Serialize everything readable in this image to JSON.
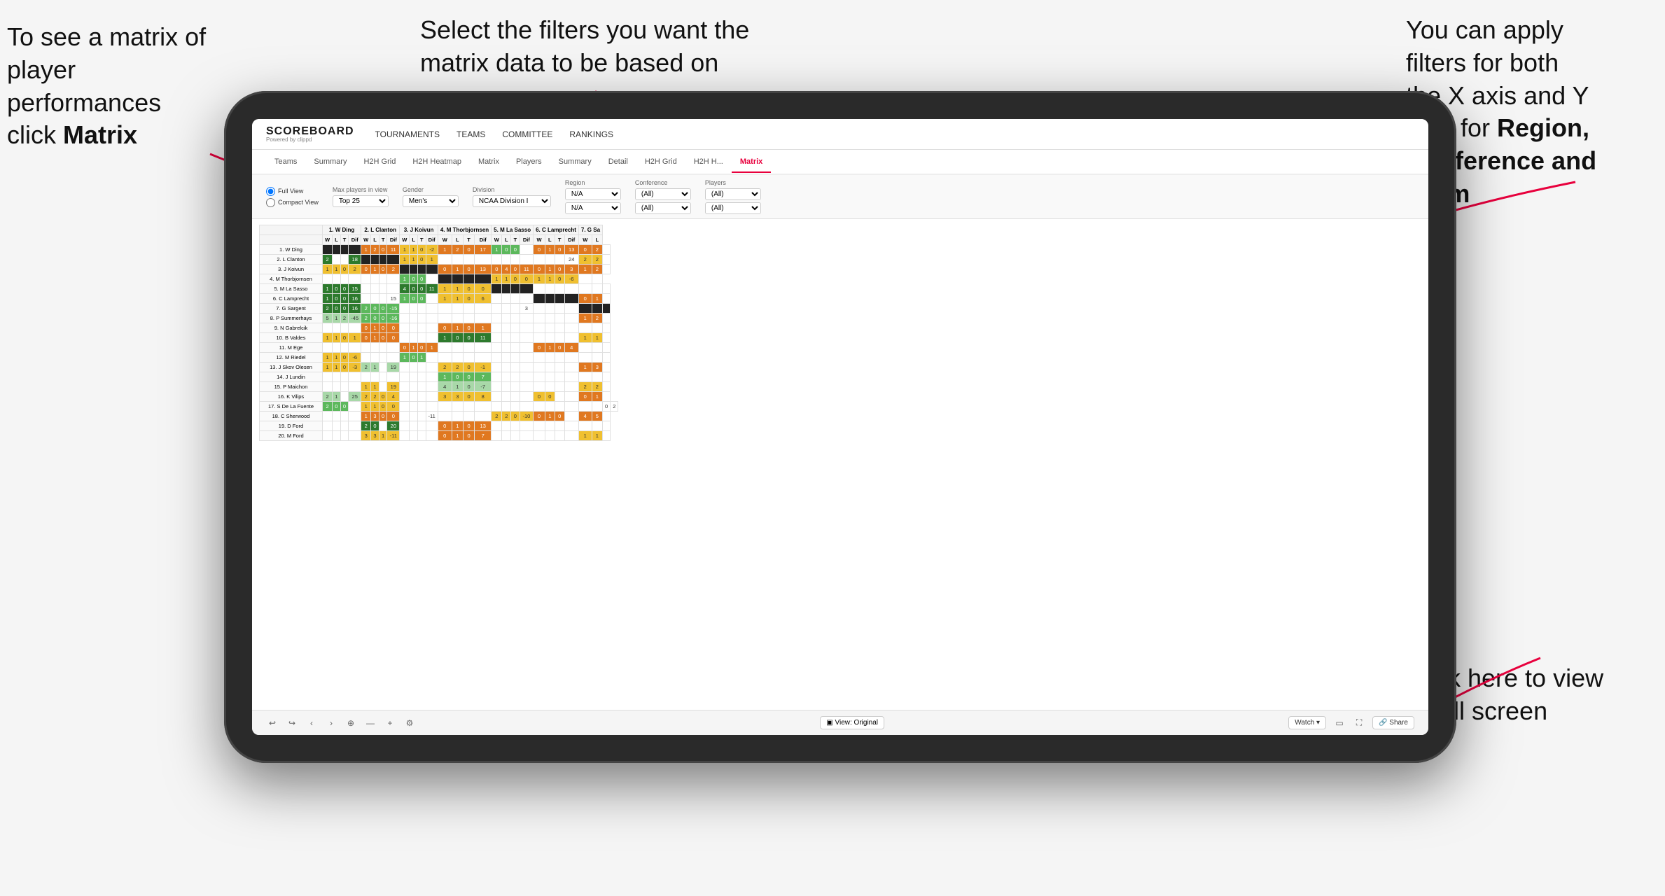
{
  "annotations": {
    "top_left": {
      "line1": "To see a matrix of",
      "line2": "player performances",
      "line3_plain": "click ",
      "line3_bold": "Matrix"
    },
    "top_center": {
      "text": "Select the filters you want the matrix data to be based on"
    },
    "top_right": {
      "line1": "You  can apply",
      "line2": "filters for both",
      "line3": "the X axis and Y",
      "line4_plain": "Axis for ",
      "line4_bold": "Region,",
      "line5_bold": "Conference and",
      "line6_bold": "Team"
    },
    "bottom_right": {
      "line1": "Click here to view",
      "line2": "in full screen"
    }
  },
  "nav": {
    "logo": "SCOREBOARD",
    "logo_sub": "Powered by clippd",
    "items": [
      "TOURNAMENTS",
      "TEAMS",
      "COMMITTEE",
      "RANKINGS"
    ]
  },
  "tabs": {
    "player_tabs": [
      "Teams",
      "Summary",
      "H2H Grid",
      "H2H Heatmap",
      "Matrix",
      "Players",
      "Summary",
      "Detail",
      "H2H Grid",
      "H2H H...",
      "Matrix"
    ],
    "active_tab": "Matrix"
  },
  "filters": {
    "view_options": [
      "Full View",
      "Compact View"
    ],
    "max_players_label": "Max players in view",
    "max_players_value": "Top 25",
    "gender_label": "Gender",
    "gender_value": "Men's",
    "division_label": "Division",
    "division_value": "NCAA Division I",
    "region_label": "Region",
    "region_value1": "N/A",
    "region_value2": "N/A",
    "conference_label": "Conference",
    "conference_value1": "(All)",
    "conference_value2": "(All)",
    "players_label": "Players",
    "players_value1": "(All)",
    "players_value2": "(All)"
  },
  "matrix": {
    "col_headers": [
      "1. W Ding",
      "2. L Clanton",
      "3. J Koivun",
      "4. M Thorbjornsen",
      "5. M La Sasso",
      "6. C Lamprecht",
      "7. G Sa"
    ],
    "sub_headers": [
      "W",
      "L",
      "T",
      "Dif"
    ],
    "rows": [
      {
        "name": "1. W Ding",
        "cells": [
          [
            "",
            "",
            "",
            ""
          ],
          [
            "1",
            "2",
            "0",
            "11"
          ],
          [
            "1",
            "1",
            "0",
            "-2"
          ],
          [
            "1",
            "2",
            "0",
            "17"
          ],
          [
            "1",
            "0",
            "0",
            ""
          ],
          [
            "0",
            "1",
            "0",
            "13"
          ],
          [
            "0",
            "2",
            ""
          ]
        ]
      },
      {
        "name": "2. L Clanton",
        "cells": [
          [
            "2",
            "",
            "",
            "18"
          ],
          [
            "",
            "",
            "",
            ""
          ],
          [
            "1",
            "1",
            "0",
            "1"
          ],
          [
            "",
            "",
            "",
            ""
          ],
          [
            "",
            "",
            "",
            ""
          ],
          [
            "",
            "",
            "",
            "24"
          ],
          [
            "2",
            "2",
            ""
          ]
        ]
      },
      {
        "name": "3. J Koivun",
        "cells": [
          [
            "1",
            "1",
            "0",
            "2"
          ],
          [
            "0",
            "1",
            "0",
            "2"
          ],
          [
            "",
            "",
            "",
            ""
          ],
          [
            "0",
            "1",
            "0",
            "13"
          ],
          [
            "0",
            "4",
            "0",
            "11"
          ],
          [
            "0",
            "1",
            "0",
            "3"
          ],
          [
            "1",
            "2",
            ""
          ]
        ]
      },
      {
        "name": "4. M Thorbjornsen",
        "cells": [
          [
            "",
            "",
            "",
            ""
          ],
          [
            "",
            "",
            "",
            ""
          ],
          [
            "1",
            "0",
            "0",
            ""
          ],
          [
            "",
            "",
            "",
            ""
          ],
          [
            "1",
            "1",
            "0",
            "0"
          ],
          [
            "1",
            "1",
            "0",
            "-6"
          ],
          [
            "",
            ""
          ]
        ]
      },
      {
        "name": "5. M La Sasso",
        "cells": [
          [
            "1",
            "0",
            "0",
            "15"
          ],
          [
            "",
            "",
            "",
            ""
          ],
          [
            "4",
            "0",
            "0",
            "11"
          ],
          [
            "1",
            "1",
            "0",
            "0"
          ],
          [
            "",
            "",
            "",
            ""
          ],
          [
            "",
            "",
            "",
            ""
          ],
          [
            "",
            "",
            ""
          ]
        ]
      },
      {
        "name": "6. C Lamprecht",
        "cells": [
          [
            "1",
            "0",
            "0",
            "16"
          ],
          [
            "",
            "",
            "",
            "15"
          ],
          [
            "1",
            "0",
            "0",
            ""
          ],
          [
            "1",
            "1",
            "0",
            "6"
          ],
          [
            "",
            "",
            "",
            ""
          ],
          [
            "",
            "",
            "",
            ""
          ],
          [
            "0",
            "1",
            ""
          ]
        ]
      },
      {
        "name": "7. G Sargent",
        "cells": [
          [
            "2",
            "0",
            "0",
            "16"
          ],
          [
            "2",
            "0",
            "0",
            "-15"
          ],
          [
            "",
            "",
            "",
            ""
          ],
          [
            "",
            "",
            "",
            ""
          ],
          [
            "",
            "",
            "",
            "3"
          ],
          [
            "",
            "",
            "",
            ""
          ],
          [
            "",
            "",
            ""
          ]
        ]
      },
      {
        "name": "8. P Summerhays",
        "cells": [
          [
            "5",
            "1",
            "2",
            "-45"
          ],
          [
            "2",
            "0",
            "0",
            "-16"
          ],
          [
            "",
            "",
            "",
            ""
          ],
          [
            "",
            "",
            "",
            ""
          ],
          [
            "",
            "",
            "",
            ""
          ],
          [
            "",
            "",
            "",
            ""
          ],
          [
            "1",
            "2",
            ""
          ]
        ]
      },
      {
        "name": "9. N Gabrelcik",
        "cells": [
          [
            "",
            "",
            "",
            ""
          ],
          [
            "0",
            "1",
            "0",
            "0"
          ],
          [
            "",
            "",
            "",
            ""
          ],
          [
            "0",
            "1",
            "0",
            "1"
          ],
          [
            "",
            "",
            "",
            ""
          ],
          [
            "",
            "",
            "",
            ""
          ],
          [
            "",
            "",
            ""
          ]
        ]
      },
      {
        "name": "10. B Valdes",
        "cells": [
          [
            "1",
            "1",
            "0",
            "1"
          ],
          [
            "0",
            "1",
            "0",
            "0"
          ],
          [
            "",
            "",
            "",
            ""
          ],
          [
            "1",
            "0",
            "0",
            "11"
          ],
          [
            "",
            "",
            "",
            ""
          ],
          [
            "",
            "",
            "",
            ""
          ],
          [
            "1",
            "1",
            ""
          ]
        ]
      },
      {
        "name": "11. M Ege",
        "cells": [
          [
            "",
            "",
            "",
            ""
          ],
          [
            "",
            "",
            "",
            ""
          ],
          [
            "0",
            "1",
            "0",
            "1"
          ],
          [
            "",
            "",
            "",
            ""
          ],
          [
            "",
            "",
            "",
            ""
          ],
          [
            "0",
            "1",
            "0",
            "4"
          ],
          [
            "",
            "",
            ""
          ]
        ]
      },
      {
        "name": "12. M Riedel",
        "cells": [
          [
            "1",
            "1",
            "0",
            "-6"
          ],
          [
            "",
            "",
            "",
            ""
          ],
          [
            "1",
            "0",
            "1",
            ""
          ],
          [
            "",
            "",
            "",
            ""
          ],
          [
            "",
            "",
            "",
            ""
          ],
          [
            "",
            "",
            "",
            ""
          ],
          [
            "",
            "",
            ""
          ]
        ]
      },
      {
        "name": "13. J Skov Olesen",
        "cells": [
          [
            "1",
            "1",
            "0",
            "-3"
          ],
          [
            "2",
            "1",
            "",
            "19"
          ],
          [
            "",
            "",
            "",
            ""
          ],
          [
            "2",
            "2",
            "0",
            "-1"
          ],
          [
            "",
            "",
            "",
            ""
          ],
          [
            "",
            "",
            "",
            ""
          ],
          [
            "1",
            "3",
            ""
          ]
        ]
      },
      {
        "name": "14. J Lundin",
        "cells": [
          [
            "",
            "",
            "",
            ""
          ],
          [
            "",
            "",
            "",
            ""
          ],
          [
            "",
            "",
            "",
            ""
          ],
          [
            "1",
            "0",
            "0",
            "7"
          ],
          [
            "",
            "",
            "",
            ""
          ],
          [
            "",
            "",
            "",
            ""
          ],
          [
            "",
            "",
            ""
          ]
        ]
      },
      {
        "name": "15. P Maichon",
        "cells": [
          [
            "",
            "",
            "",
            ""
          ],
          [
            "1",
            "1",
            "",
            "19"
          ],
          [
            "",
            "",
            "",
            ""
          ],
          [
            "4",
            "1",
            "0",
            "-7"
          ],
          [
            "",
            "",
            "",
            ""
          ],
          [
            "",
            "",
            "",
            ""
          ],
          [
            "2",
            "2",
            ""
          ]
        ]
      },
      {
        "name": "16. K Vilips",
        "cells": [
          [
            "2",
            "1",
            "",
            "25"
          ],
          [
            "2",
            "2",
            "0",
            "4"
          ],
          [
            "",
            "",
            "",
            ""
          ],
          [
            "3",
            "3",
            "0",
            "8"
          ],
          [
            "",
            "",
            "",
            ""
          ],
          [
            "0",
            "0",
            "",
            ""
          ],
          [
            "0",
            "1",
            ""
          ]
        ]
      },
      {
        "name": "17. S De La Fuente",
        "cells": [
          [
            "2",
            "0",
            "0",
            ""
          ],
          [
            "1",
            "1",
            "0",
            "0"
          ],
          [
            "",
            "",
            "",
            ""
          ],
          [
            "",
            "",
            "",
            ""
          ],
          [
            "",
            "",
            "",
            ""
          ],
          [
            "",
            "",
            "",
            ""
          ],
          [
            "",
            "",
            "0",
            "2"
          ]
        ]
      },
      {
        "name": "18. C Sherwood",
        "cells": [
          [
            "",
            "",
            "",
            ""
          ],
          [
            "1",
            "3",
            "0",
            "0"
          ],
          [
            "",
            "",
            "",
            "-11"
          ],
          [
            "",
            "",
            "",
            ""
          ],
          [
            "2",
            "2",
            "0",
            "-10"
          ],
          [
            "0",
            "1",
            "0",
            ""
          ],
          [
            "4",
            "5",
            ""
          ]
        ]
      },
      {
        "name": "19. D Ford",
        "cells": [
          [
            "",
            "",
            "",
            ""
          ],
          [
            "2",
            "0",
            "",
            "20"
          ],
          [
            "",
            "",
            "",
            ""
          ],
          [
            "0",
            "1",
            "0",
            "13"
          ],
          [
            "",
            "",
            "",
            ""
          ],
          [
            "",
            "",
            "",
            ""
          ],
          [
            "",
            "",
            ""
          ]
        ]
      },
      {
        "name": "20. M Ford",
        "cells": [
          [
            "",
            "",
            "",
            ""
          ],
          [
            "3",
            "3",
            "1",
            "-11"
          ],
          [
            "",
            "",
            "",
            ""
          ],
          [
            "0",
            "1",
            "0",
            "7"
          ],
          [
            "",
            "",
            "",
            ""
          ],
          [
            "",
            "",
            "",
            ""
          ],
          [
            "1",
            "1",
            ""
          ]
        ]
      }
    ]
  },
  "toolbar": {
    "view_label": "View: Original",
    "watch_label": "Watch",
    "share_label": "Share"
  }
}
